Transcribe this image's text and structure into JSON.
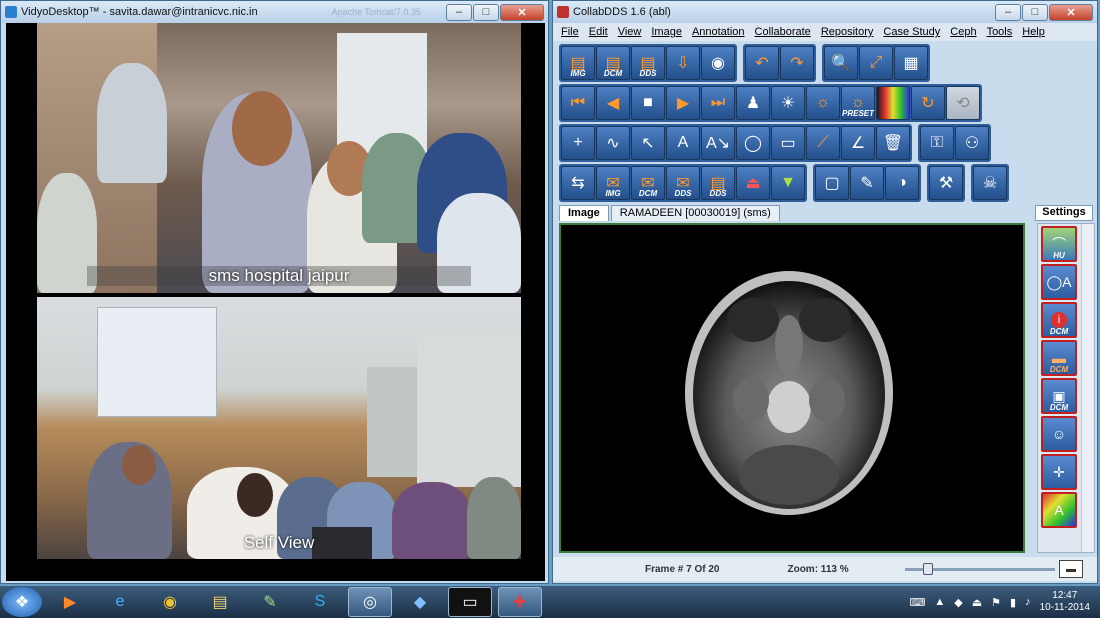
{
  "vidyo": {
    "title": "VidyoDesktop™ - savita.dawar@intranicvc.nic.in",
    "faint_title": "Apache Tomcat/7.0.35",
    "remote_label": "sms hospital jaipur",
    "self_label": "Self View"
  },
  "collab": {
    "title": "CollabDDS 1.6 (abl)",
    "menu": [
      "File",
      "Edit",
      "View",
      "Image",
      "Annotation",
      "Collaborate",
      "Repository",
      "Case Study",
      "Ceph",
      "Tools",
      "Help"
    ],
    "toolbar_subs": {
      "img": "IMG",
      "dcm": "DCM",
      "dds": "DDS",
      "preset": "PRESET"
    },
    "tab_image": "Image",
    "tab_patient": "RAMADEEN [00030019] (sms)",
    "settings_tab": "Settings",
    "sidebar_subs": {
      "hu": "HU",
      "dcm": "DCM"
    },
    "frame_label": "Frame # 7 Of 20",
    "zoom_label": "Zoom: 113 %",
    "zoom_slider_fraction": 0.12
  },
  "taskbar": {
    "time": "12:47",
    "date": "10-11-2014"
  },
  "colors": {
    "toolbar_blue": "#2f5e9b",
    "accent_orange": "#ff9a2a",
    "viewer_border": "#3a7a3a"
  }
}
